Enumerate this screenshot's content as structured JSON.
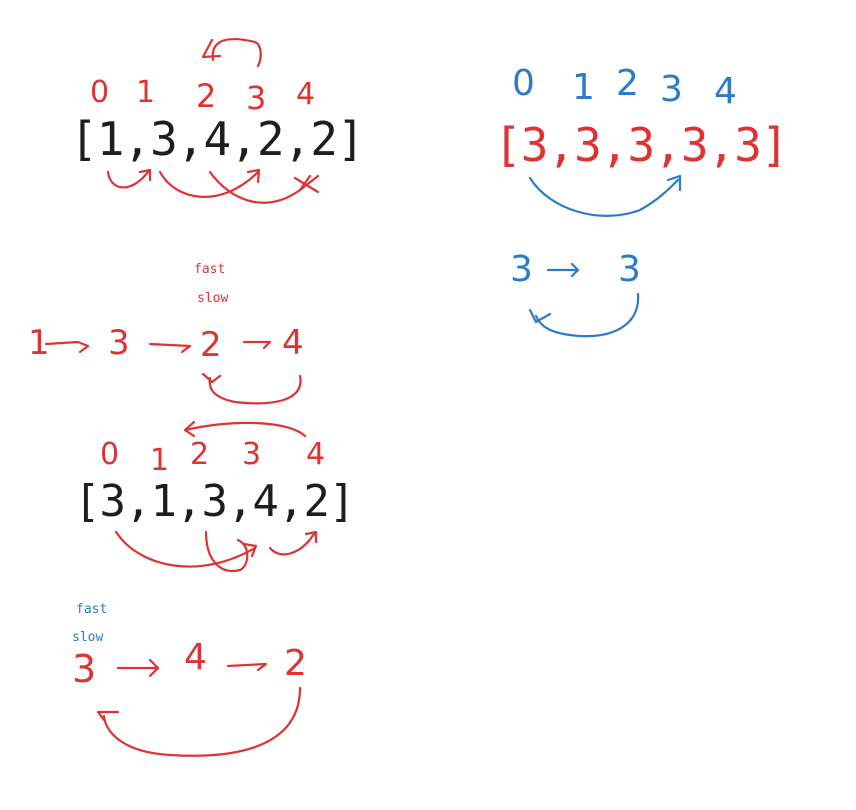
{
  "colors": {
    "red": "#dd3333",
    "blue": "#2b7bc8",
    "black": "#1e1e1e"
  },
  "example1": {
    "indices": [
      "0",
      "1",
      "2",
      "3",
      "4"
    ],
    "array": "[1,3,4,2,2]",
    "fast_label": "fast",
    "slow_label": "slow",
    "chain": [
      "1",
      "3",
      "2",
      "4"
    ]
  },
  "example2": {
    "indices": [
      "0",
      "1",
      "2",
      "3",
      "4"
    ],
    "array": "[3,1,3,4,2]",
    "fast_label": "fast",
    "slow_label": "slow",
    "chain": [
      "3",
      "4",
      "2"
    ]
  },
  "example3": {
    "indices": [
      "0",
      "1",
      "2",
      "3",
      "4"
    ],
    "array": "[3,3,3,3,3]",
    "chain": [
      "3",
      "3"
    ]
  }
}
